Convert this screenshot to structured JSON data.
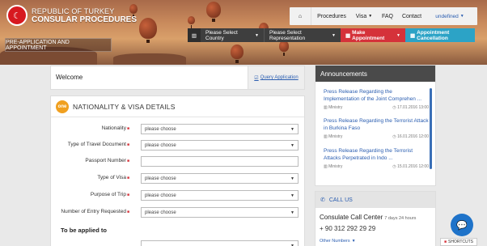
{
  "logo": {
    "line1": "REPUBLIC OF TURKEY",
    "line2": "CONSULAR PROCEDURES"
  },
  "nav": {
    "home_icon": "home-icon",
    "procedures": "Procedures",
    "visa": "Visa",
    "faq": "FAQ",
    "contact": "Contact",
    "user": "undefined"
  },
  "bar2": {
    "country": "Please Select Country",
    "representation": "Please Select Representation",
    "make": "Make Appointment",
    "cancel": "Appointment Cancellation"
  },
  "preapp": "PRE-APPLICATION AND APPOINTMENT",
  "welcome": {
    "title": "Welcome",
    "query": "Query Application"
  },
  "visa_details": {
    "badge": "one",
    "title": "NATIONALITY & VISA DETAILS",
    "rows": [
      {
        "label": "Nationality",
        "value": "please choose"
      },
      {
        "label": "Type of Travel Document",
        "value": "please choose"
      },
      {
        "label": "Passport Number",
        "value": ""
      },
      {
        "label": "Type of Visa",
        "value": "please choose"
      },
      {
        "label": "Purpose of Trip",
        "value": "please choose"
      },
      {
        "label": "Number of Entry Requested",
        "value": "please choose"
      }
    ],
    "applied_to": "To be applied to"
  },
  "announcements": {
    "title": "Announcements",
    "items": [
      {
        "text": "Press Release Regarding the Implementation of the Joint Comprehen ...",
        "source": "Ministry",
        "date": "17.01.2016 13:00"
      },
      {
        "text": "Press Release Regarding the Terrorist Attack in Burkina Faso",
        "source": "Ministry",
        "date": "16.01.2016 12:00"
      },
      {
        "text": "Press Release Regarding the Terrorist Attacks Perpetrated in Indo ...",
        "source": "Ministry",
        "date": "15.01.2016 12:00"
      }
    ]
  },
  "call": {
    "title": "CALL US",
    "center": "Consulate Call Center",
    "hours": "7 days 24 hours",
    "phone": "+ 90 312 292 29 29",
    "other": "Other Numbers"
  },
  "shortcuts": "SHORTCUTS",
  "colors": {
    "accent_red": "#d5323a",
    "accent_blue": "#2ca3c6",
    "link": "#2a5db0"
  }
}
